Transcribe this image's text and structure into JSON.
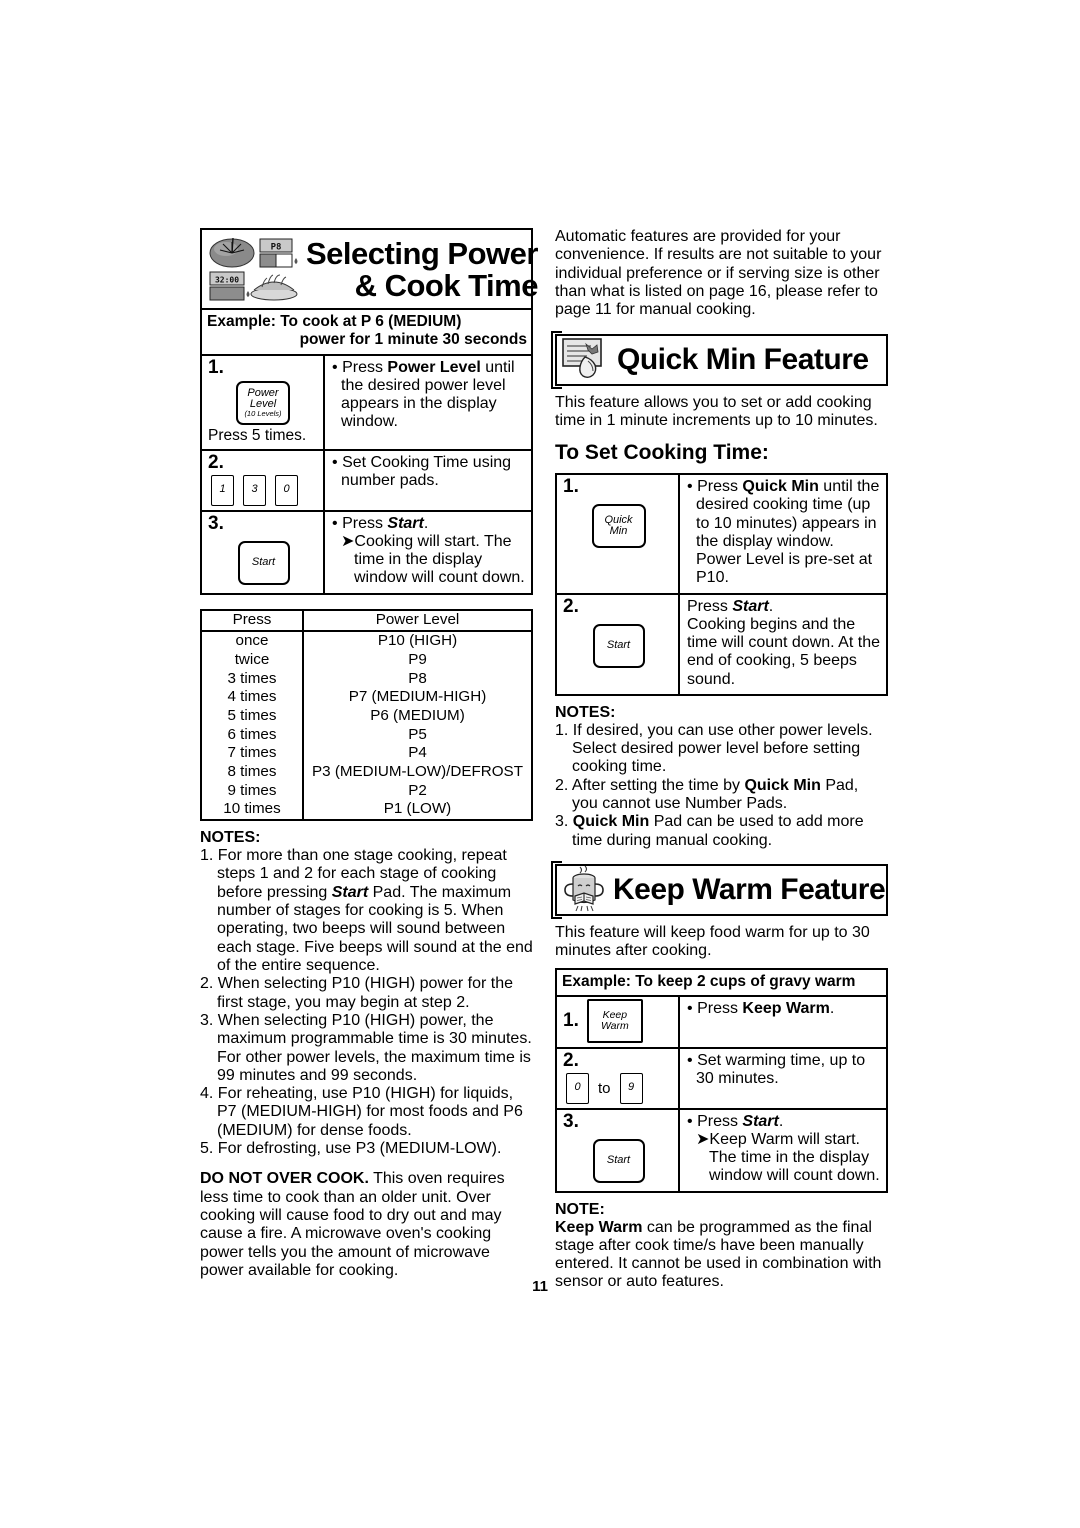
{
  "page": {
    "number": "11"
  },
  "left": {
    "banner": {
      "title_line1": "Selecting Power",
      "title_line2": "& Cook Time",
      "art_label": "power-level-and-food-icons",
      "display_text_1": "P8",
      "display_text_2": "32:00"
    },
    "example": {
      "line1": "Example: To cook at P 6 (MEDIUM)",
      "line2": "power for 1 minute 30 seconds"
    },
    "steps": [
      {
        "num": "1.",
        "pad_line1": "Power",
        "pad_line2": "Level",
        "pad_line3": "(10 Levels)",
        "caption": "Press 5 times.",
        "text": "• Press Power Level until the desired power level appears in the display window.",
        "bullet": "•",
        "text_plain_a": "Press ",
        "text_bold": "Power Level",
        "text_plain_b": " until the desired power level appears in the display window."
      },
      {
        "num": "2.",
        "pads": [
          "1",
          "3",
          "0"
        ],
        "bullet": "•",
        "text": "Set Cooking Time using number pads."
      },
      {
        "num": "3.",
        "pad_label": "Start",
        "bullet": "•",
        "line1_plain": "Press ",
        "line1_bold": "Start",
        "line1_end": ".",
        "arrow": "➤",
        "line2": "Cooking will start. The time in the display window will count down."
      }
    ],
    "power_table": {
      "header": {
        "press": "Press",
        "level": "Power Level"
      },
      "rows": [
        {
          "press": "once",
          "level": "P10 (HIGH)"
        },
        {
          "press": "twice",
          "level": "P9"
        },
        {
          "press": "3 times",
          "level": "P8"
        },
        {
          "press": "4 times",
          "level": "P7 (MEDIUM-HIGH)"
        },
        {
          "press": "5 times",
          "level": "P6 (MEDIUM)"
        },
        {
          "press": "6 times",
          "level": "P5"
        },
        {
          "press": "7 times",
          "level": "P4"
        },
        {
          "press": "8 times",
          "level": "P3 (MEDIUM-LOW)/DEFROST"
        },
        {
          "press": "9 times",
          "level": "P2"
        },
        {
          "press": "10 times",
          "level": "P1 (LOW)"
        }
      ]
    },
    "notes": {
      "title": "NOTES:",
      "items": [
        {
          "num": "1.",
          "pre": "For more than one stage cooking, repeat steps 1 and 2 for each stage of cooking before pressing ",
          "bold": "Start",
          "post": " Pad. The maximum number of stages for cooking is 5. When operating, two beeps will sound between each stage. Five beeps will sound at the end of the entire sequence."
        },
        {
          "num": "2.",
          "pre": "When selecting P10 (HIGH) power for the first stage, you may begin at step 2.",
          "bold": "",
          "post": ""
        },
        {
          "num": "3.",
          "pre": "When selecting P10 (HIGH) power, the maximum programmable time is 30 minutes. For other power levels, the maximum time is 99 minutes and 99 seconds.",
          "bold": "",
          "post": ""
        },
        {
          "num": "4.",
          "pre": "For reheating, use P10 (HIGH) for liquids, P7 (MEDIUM-HIGH) for most foods and P6 (MEDIUM) for dense foods.",
          "bold": "",
          "post": ""
        },
        {
          "num": "5.",
          "pre": "For defrosting, use P3 (MEDIUM-LOW).",
          "bold": "",
          "post": ""
        }
      ]
    },
    "warning": {
      "bold": "DO NOT OVER COOK.",
      "text": " This oven requires less time to cook than an older unit. Over cooking will cause food to dry out and may cause a fire. A microwave oven's cooking power tells you the amount of microwave power available for cooking."
    }
  },
  "right": {
    "intro": "Automatic features are provided for your convenience. If results are not suitable to your individual preference or if serving size is other than what is listed on page 16, please refer to page 11 for manual cooking.",
    "quick_min": {
      "banner_title": "Quick Min Feature",
      "banner_art": "hand-pressing-control-panel-icon",
      "description": "This feature allows you to set or add cooking time in 1 minute increments up to 10 minutes.",
      "section_head": "To Set Cooking Time:",
      "steps": [
        {
          "num": "1.",
          "pad_line1": "Quick",
          "pad_line2": "Min",
          "bullet": "•",
          "pre": "Press ",
          "bold": "Quick Min",
          "post": " until the desired cooking time (up to 10 minutes) appears in the display window. Power Level is pre-set at P10."
        },
        {
          "num": "2.",
          "pad_label": "Start",
          "line1_plain": "Press ",
          "line1_bold": "Start",
          "line1_end": ".",
          "line2": "Cooking begins and the time will count down. At the end of cooking, 5 beeps sound."
        }
      ],
      "notes_title": "NOTES:",
      "notes": [
        {
          "num": "1.",
          "pre": "If desired, you can use other power levels. Select desired power level before setting cooking time.",
          "bold": "",
          "post": ""
        },
        {
          "num": "2.",
          "pre": "After setting the time by ",
          "bold": "Quick Min",
          "post": " Pad, you cannot use Number Pads."
        },
        {
          "num": "3.",
          "pre": "",
          "bold": "Quick Min",
          "post": " Pad can be used to add more time during manual cooking."
        }
      ]
    },
    "keep_warm": {
      "banner_title": "Keep Warm Feature",
      "banner_art": "steaming-cup-reading-book-icon",
      "description": "This feature will keep food warm for up to 30 minutes after cooking.",
      "example": "Example: To keep 2 cups of gravy warm",
      "steps": [
        {
          "num": "1.",
          "pad_line1": "Keep",
          "pad_line2": "Warm",
          "bullet": "•",
          "pre": "Press ",
          "bold": "Keep Warm",
          "post": "."
        },
        {
          "num": "2.",
          "pad_from": "0",
          "pad_to_label": "to",
          "pad_to": "9",
          "bullet": "•",
          "text": "Set warming time, up to 30 minutes."
        },
        {
          "num": "3.",
          "pad_label": "Start",
          "bullet": "•",
          "line1_plain": "Press ",
          "line1_bold": "Start",
          "line1_end": ".",
          "arrow": "➤",
          "line2": "Keep Warm will start. The time in the display window will count down."
        }
      ],
      "note_title": "NOTE:",
      "note_bold": "Keep Warm",
      "note_text": " can be programmed as the final stage after cook time/s have been manually entered. It cannot be used in combination with sensor or auto features."
    }
  }
}
